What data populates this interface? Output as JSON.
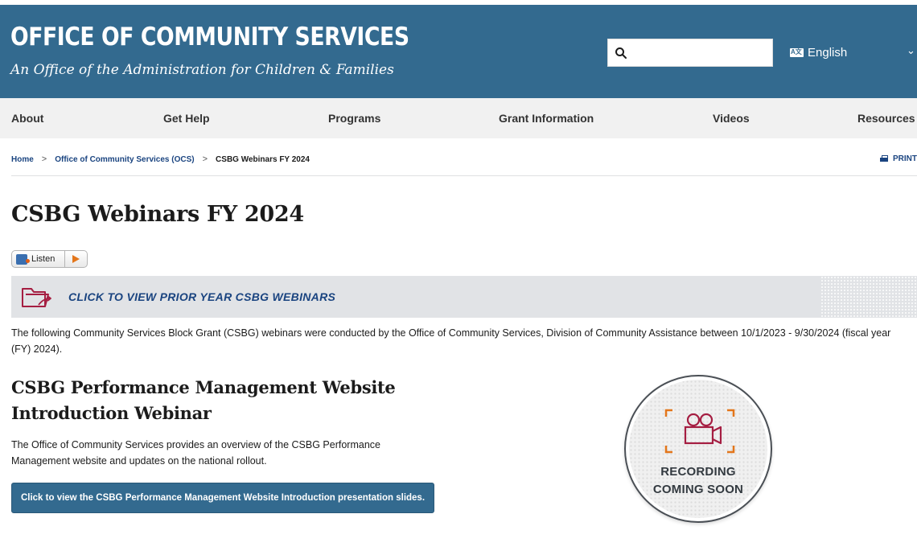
{
  "header": {
    "title": "OFFICE OF COMMUNITY SERVICES",
    "subtitle": "An Office of the Administration for Children & Families",
    "search_placeholder": "",
    "language": "English"
  },
  "nav": {
    "items": [
      {
        "label": "About"
      },
      {
        "label": "Get Help"
      },
      {
        "label": "Programs"
      },
      {
        "label": "Grant Information"
      },
      {
        "label": "Videos"
      },
      {
        "label": "Resources"
      }
    ]
  },
  "breadcrumb": {
    "home": "Home",
    "parent": "Office of Community Services (OCS)",
    "current": "CSBG Webinars FY 2024"
  },
  "print_label": "PRINT",
  "page_title": "CSBG Webinars FY 2024",
  "listen": {
    "label": "Listen"
  },
  "banner": {
    "text": "CLICK TO VIEW PRIOR YEAR CSBG WEBINARS"
  },
  "intro": "The following Community Services Block Grant (CSBG) webinars were conducted by the Office of Community Services, Division of Community Assistance between 10/1/2023 - 9/30/2024 (fiscal year (FY) 2024).",
  "section": {
    "title_line1": "CSBG Performance Management Website",
    "title_line2": "Introduction Webinar",
    "description": "The Office of Community Services provides an overview of the CSBG Performance Management website and updates on the national rollout.",
    "button_label": "Click to view the CSBG Performance Management Website Introduction presentation slides.",
    "badge_line1": "RECORDING",
    "badge_line2": "COMING SOON"
  },
  "colors": {
    "header_bg": "#336a8f",
    "nav_bg": "#f1f1f1",
    "link": "#1a4480",
    "accent_orange": "#e3761b",
    "camera": "#a51e42"
  }
}
